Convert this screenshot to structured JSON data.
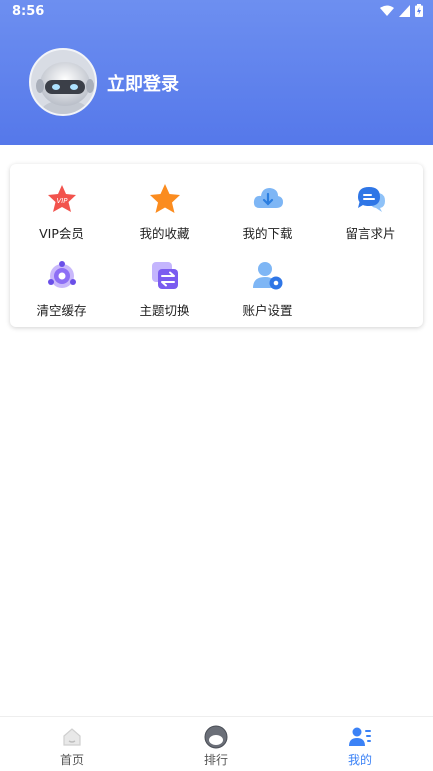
{
  "status_bar": {
    "time": "8:56"
  },
  "header": {
    "login_label": "立即登录"
  },
  "menu": {
    "items": [
      {
        "label": "VIP会员"
      },
      {
        "label": "我的收藏"
      },
      {
        "label": "我的下载"
      },
      {
        "label": "留言求片"
      },
      {
        "label": "清空缓存"
      },
      {
        "label": "主题切换"
      },
      {
        "label": "账户设置"
      }
    ]
  },
  "tabbar": {
    "tabs": [
      {
        "label": "首页"
      },
      {
        "label": "排行"
      },
      {
        "label": "我的"
      }
    ],
    "active_color": "#3b82f6"
  }
}
